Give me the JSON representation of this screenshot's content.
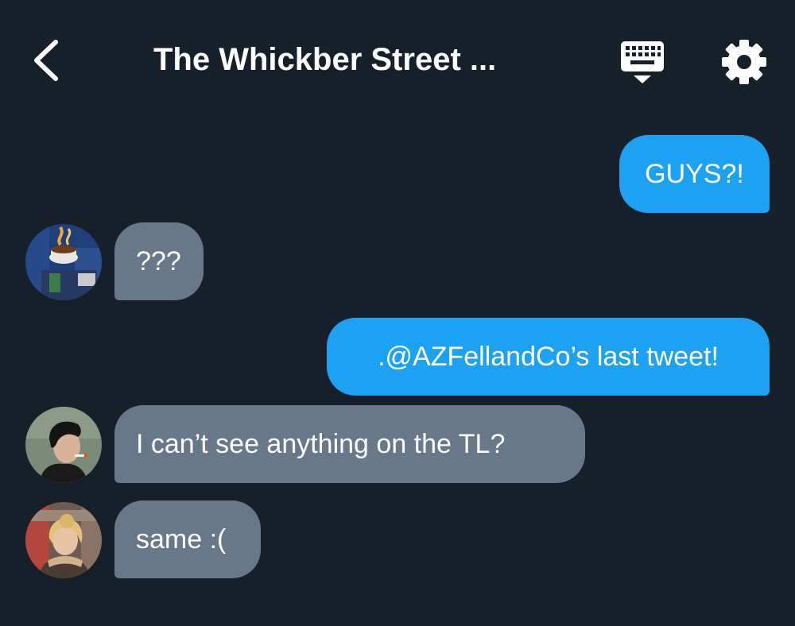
{
  "header": {
    "title": "The Whickber Street ...",
    "back_icon": "chevron-left-icon",
    "keyboard_icon": "keyboard-icon",
    "settings_icon": "gear-icon"
  },
  "messages": [
    {
      "direction": "out",
      "text": "GUYS?!"
    },
    {
      "direction": "in",
      "text": "???",
      "avatar": "avatar-coffee-mural"
    },
    {
      "direction": "out",
      "text": ".@AZFellandCo’s last tweet!"
    },
    {
      "direction": "in",
      "text": "I can’t see anything on the TL?",
      "avatar": "avatar-dark-hair-person"
    },
    {
      "direction": "in",
      "text": "same :(",
      "avatar": "avatar-blonde-person"
    }
  ],
  "colors": {
    "background": "#15202b",
    "outgoing_bubble": "#1da1f2",
    "incoming_bubble": "#66788a",
    "text": "#ffffff"
  }
}
